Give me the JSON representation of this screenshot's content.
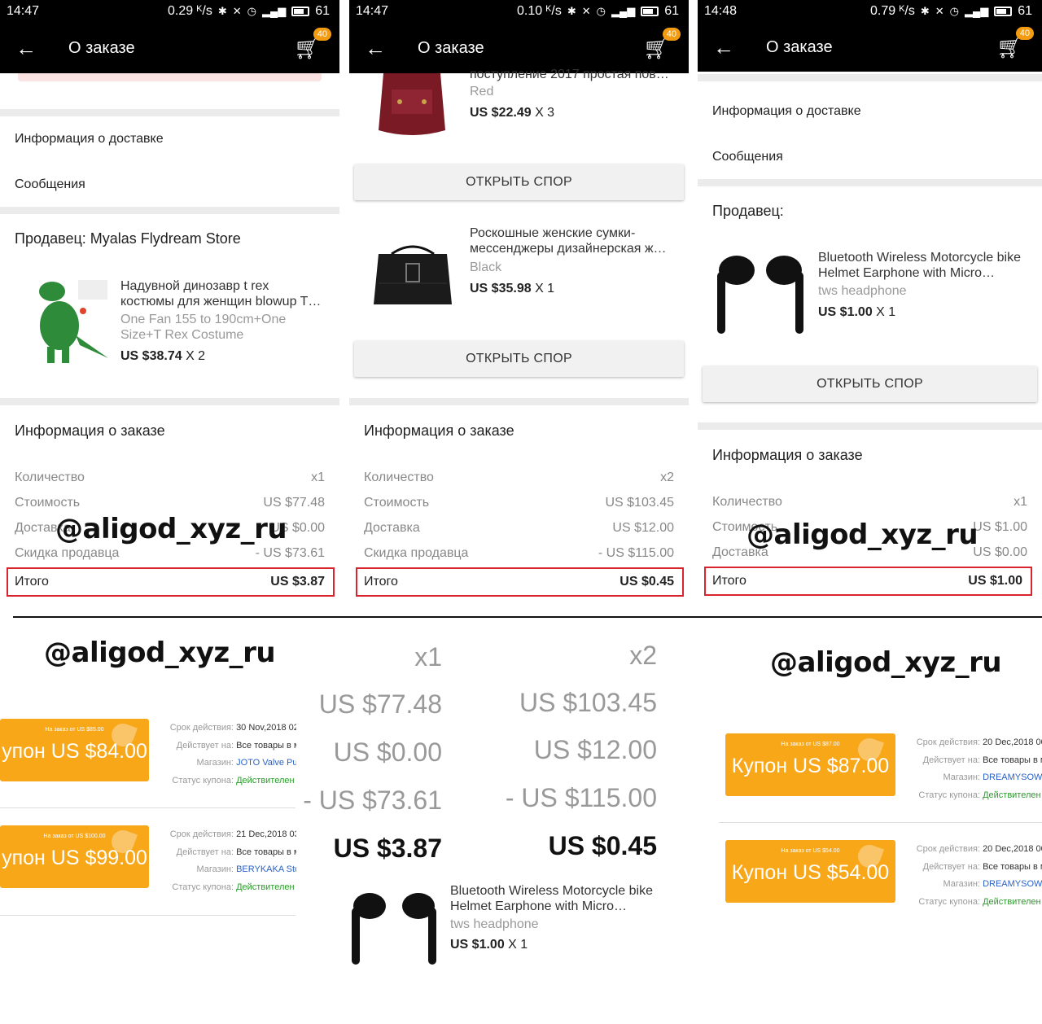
{
  "accent_color": "#f8a718",
  "watermark": "@aligod_xyz_ru",
  "panels": [
    {
      "status": {
        "time": "14:47",
        "speed": "0.29 ᴷ/s",
        "battery": "61"
      },
      "appbar": {
        "title": "О заказе",
        "cart_badge": "40"
      },
      "delivery_info": "Информация о доставке",
      "messages": "Сообщения",
      "seller": "Продавец: Myalas Flydream Store",
      "product": {
        "title": "Надувной динозавр t rex костюмы для женщин blowup T…",
        "variant": "One Fan 155 to 190cm+One Size+T Rex Costume",
        "price": "US $38.74",
        "qty": "X 2"
      },
      "order_info": "Информация о заказе",
      "rows": [
        {
          "label": "Количество",
          "value": "x1"
        },
        {
          "label": "Стоимость",
          "value": "US $77.48"
        },
        {
          "label": "Доставка",
          "value": "US $0.00"
        },
        {
          "label": "Скидка продавца",
          "value": "- US $73.61"
        }
      ],
      "total": {
        "label": "Итого",
        "value": "US $3.87"
      }
    },
    {
      "status": {
        "time": "14:47",
        "speed": "0.10 ᴷ/s",
        "battery": "61"
      },
      "appbar": {
        "title": "О заказе",
        "cart_badge": "40"
      },
      "product_a": {
        "title": "поступление 2017 простая пов…",
        "variant": "Red",
        "price": "US $22.49",
        "qty": "X 3"
      },
      "dispute": "ОТКРЫТЬ СПОР",
      "product_b": {
        "title": "Роскошные женские сумки-мессенджеры дизайнерская ж…",
        "variant": "Black",
        "price": "US $35.98",
        "qty": "X 1"
      },
      "order_info": "Информация о заказе",
      "rows": [
        {
          "label": "Количество",
          "value": "x2"
        },
        {
          "label": "Стоимость",
          "value": "US $103.45"
        },
        {
          "label": "Доставка",
          "value": "US $12.00"
        },
        {
          "label": "Скидка продавца",
          "value": "- US $115.00"
        }
      ],
      "total": {
        "label": "Итого",
        "value": "US $0.45"
      }
    },
    {
      "status": {
        "time": "14:48",
        "speed": "0.79 ᴷ/s",
        "battery": "61"
      },
      "appbar": {
        "title": "О заказе",
        "cart_badge": "40"
      },
      "delivery_info": "Информация о доставке",
      "messages": "Сообщения",
      "seller": "Продавец:",
      "product": {
        "title": "Bluetooth Wireless Motorcycle bike Helmet Earphone with Micro…",
        "variant": "tws headphone",
        "price": "US $1.00",
        "qty": "X 1"
      },
      "dispute": "ОТКРЫТЬ СПОР",
      "order_info": "Информация о заказе",
      "rows": [
        {
          "label": "Количество",
          "value": "x1"
        },
        {
          "label": "Стоимость",
          "value": "US $1.00"
        },
        {
          "label": "Доставка",
          "value": "US $0.00"
        }
      ],
      "total": {
        "label": "Итого",
        "value": "US $1.00"
      }
    }
  ],
  "coupons_left": [
    {
      "small": "На заказ от US $85.00",
      "amount": "упон US $84.00",
      "validity_label": "Срок действия:",
      "validity": "30 Nov,2018 02",
      "applies_label": "Действует на:",
      "applies": "Все товары в м",
      "store_label": "Магазин:",
      "store": "JOTO Valve Pur",
      "status_label": "Статус купона:",
      "status": "Действителен"
    },
    {
      "small": "На заказ от US $100.00",
      "amount": "упон US $99.00",
      "validity_label": "Срок действия:",
      "validity": "21 Dec,2018 03",
      "applies_label": "Действует на:",
      "applies": "Все товары в м",
      "store_label": "Магазин:",
      "store": "BERYKAKA Stor",
      "status_label": "Статус купона:",
      "status": "Действителен"
    }
  ],
  "coupons_right": [
    {
      "small": "На заказ от US $87.00",
      "amount": "Купон US $87.00",
      "validity_label": "Срок действия:",
      "validity": "20 Dec,2018 00",
      "applies_label": "Действует на:",
      "applies": "Все товары в м",
      "store_label": "Магазин:",
      "store": "DREAMYSOW A",
      "status_label": "Статус купона:",
      "status": "Действителен"
    },
    {
      "small": "На заказ от US $54.00",
      "amount": "Купон US $54.00",
      "validity_label": "Срок действия:",
      "validity": "20 Dec,2018 00",
      "applies_label": "Действует на:",
      "applies": "Все товары в м",
      "store_label": "Магазин:",
      "store": "DREAMYSOW A",
      "status_label": "Статус купона:",
      "status": "Действителен"
    }
  ],
  "zoom_left": [
    "x1",
    "US $77.48",
    "US $0.00",
    "- US $73.61",
    "US $3.87"
  ],
  "zoom_right": [
    "x2",
    "US $103.45",
    "US $12.00",
    "- US $115.00",
    "US $0.45"
  ],
  "zoom_product": {
    "title": "Bluetooth Wireless Motorcycle bike Helmet Earphone with Micro…",
    "variant": "tws headphone",
    "price": "US $1.00",
    "qty": "X 1"
  }
}
